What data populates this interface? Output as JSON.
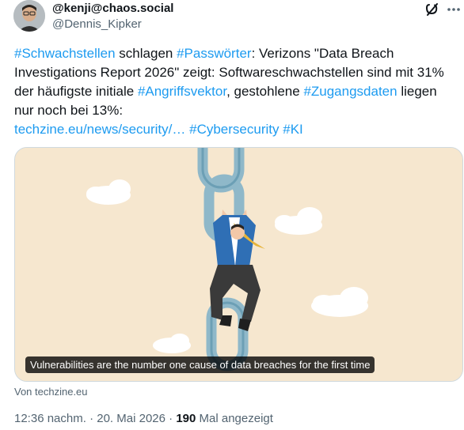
{
  "post": {
    "handle": "@kenji@chaos.social",
    "subhandle": "@Dennis_Kipker",
    "text_parts": [
      {
        "text": "#Schwachstellen",
        "type": "tag"
      },
      {
        "text": " schlagen ",
        "type": "plain"
      },
      {
        "text": "#Passwörter",
        "type": "tag"
      },
      {
        "text": ": Verizons \"Data Breach Investigations Report 2026\" zeigt: Softwareschwachstellen sind mit 31% der häufigste initiale ",
        "type": "plain"
      },
      {
        "text": "#Angriffsvektor",
        "type": "tag"
      },
      {
        "text": ", gestohlene ",
        "type": "plain"
      },
      {
        "text": "#Zugangsdaten",
        "type": "tag"
      },
      {
        "text": " liegen nur noch bei 13%:",
        "type": "plain"
      }
    ],
    "link_line": {
      "url": "techzine.eu/news/security/…",
      "tags": [
        "#Cybersecurity",
        "#KI"
      ]
    }
  },
  "card": {
    "caption": "Vulnerabilities are the number one cause of data breaches for the first time",
    "source": "Von techzine.eu"
  },
  "meta": {
    "time": "12:36 nachm.",
    "date": "20. Mai 2026",
    "views": "190",
    "views_label": "Mal angezeigt"
  },
  "icons": {
    "top_right": [
      "mastodon-icon",
      "more-menu-icon"
    ]
  },
  "colors": {
    "link": "#1d9bf0",
    "text": "#0f1419",
    "muted": "#536471",
    "card_bg": "#f6e7cf",
    "chain": "#8fb8c9"
  }
}
